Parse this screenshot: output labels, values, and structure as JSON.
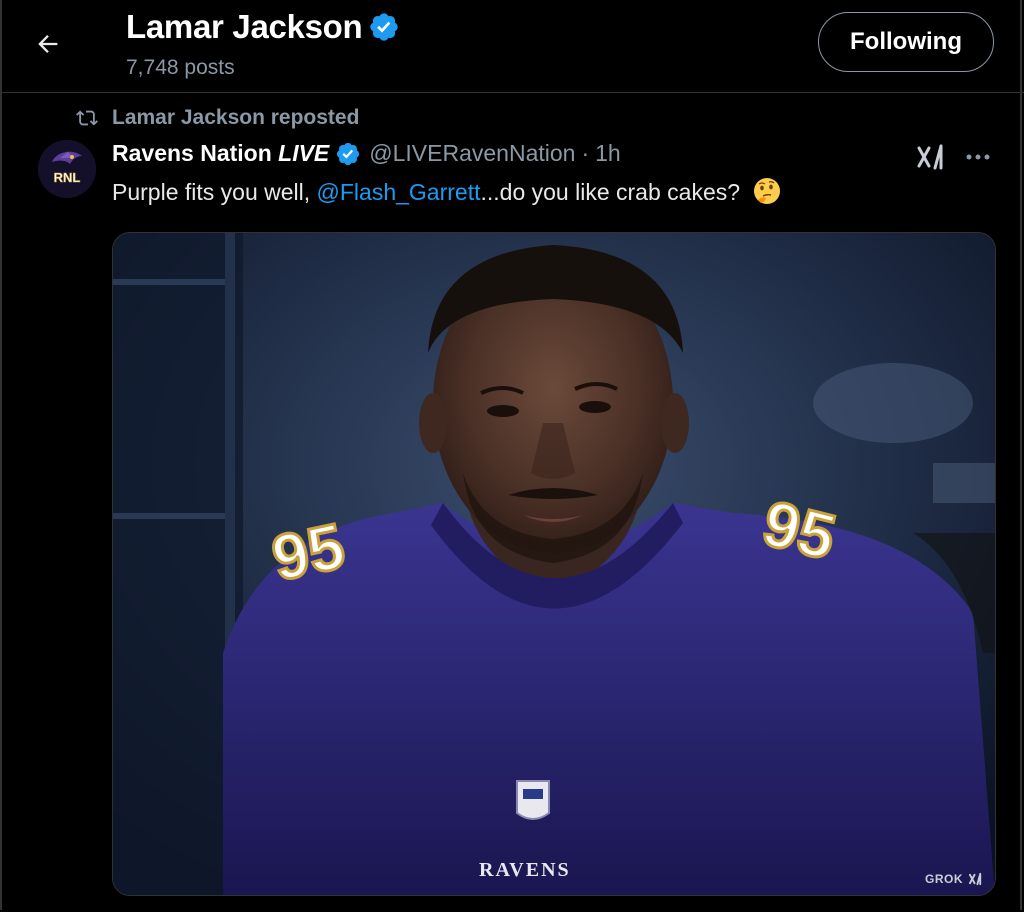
{
  "header": {
    "title": "Lamar Jackson",
    "posts_count": "7,748 posts",
    "follow_label": "Following"
  },
  "repost": {
    "text": "Lamar Jackson reposted"
  },
  "post": {
    "author_name": "Ravens Nation",
    "author_suffix": "LIVE",
    "handle": "@LIVERavenNation",
    "separator": "·",
    "time": "1h",
    "text_before": "Purple fits you well, ",
    "mention": "@Flash_Garrett",
    "text_after": "...do you like crab cakes?",
    "avatar_text": "RNL"
  },
  "media": {
    "jersey_number": "95",
    "wordmark": "RAVENS",
    "watermark": "GROK"
  },
  "colors": {
    "background": "#000000",
    "accent": "#1d9bf0",
    "muted": "#8b98a5",
    "verified": "#1d9bf0",
    "jersey": "#2a2670"
  },
  "icons": [
    "back-arrow-icon",
    "verified-icon",
    "repost-icon",
    "grok-icon",
    "more-icon",
    "thinking-emoji-icon"
  ]
}
